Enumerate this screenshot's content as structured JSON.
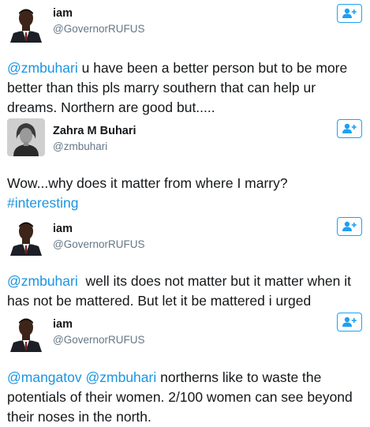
{
  "tweets": [
    {
      "name": "iam",
      "handle": "@GovernorRUFUS",
      "avatar_icon": "man-suit-avatar-icon",
      "follow_icon": "add-user-icon",
      "mention1": "@zmbuhari",
      "text": " u have been a better person but to be more better than this pls marry southern that can help ur dreams. Northern are good but....."
    },
    {
      "name": "Zahra M Buhari",
      "handle": "@zmbuhari",
      "avatar_icon": "woman-avatar-icon",
      "follow_icon": "add-user-icon",
      "text": "Wow...why does it matter from where I marry?",
      "hashtag": "#interesting"
    },
    {
      "name": "iam",
      "handle": "@GovernorRUFUS",
      "avatar_icon": "man-suit-avatar-icon",
      "follow_icon": "add-user-icon",
      "mention1": "@zmbuhari",
      "text": "  well its does not matter but it matter when it has not be mattered. But let it be mattered i urged"
    },
    {
      "name": "iam",
      "handle": "@GovernorRUFUS",
      "avatar_icon": "man-suit-avatar-icon",
      "follow_icon": "add-user-icon",
      "mention1": "@mangatov",
      "mention2": "@zmbuhari",
      "text": " northerns like to waste the potentials of their women. 2/100 women can see beyond their noses in the north."
    }
  ],
  "colors": {
    "link": "#1b95e0",
    "follow_border": "#1da1f2",
    "handle": "#657786",
    "text": "#14171a"
  }
}
